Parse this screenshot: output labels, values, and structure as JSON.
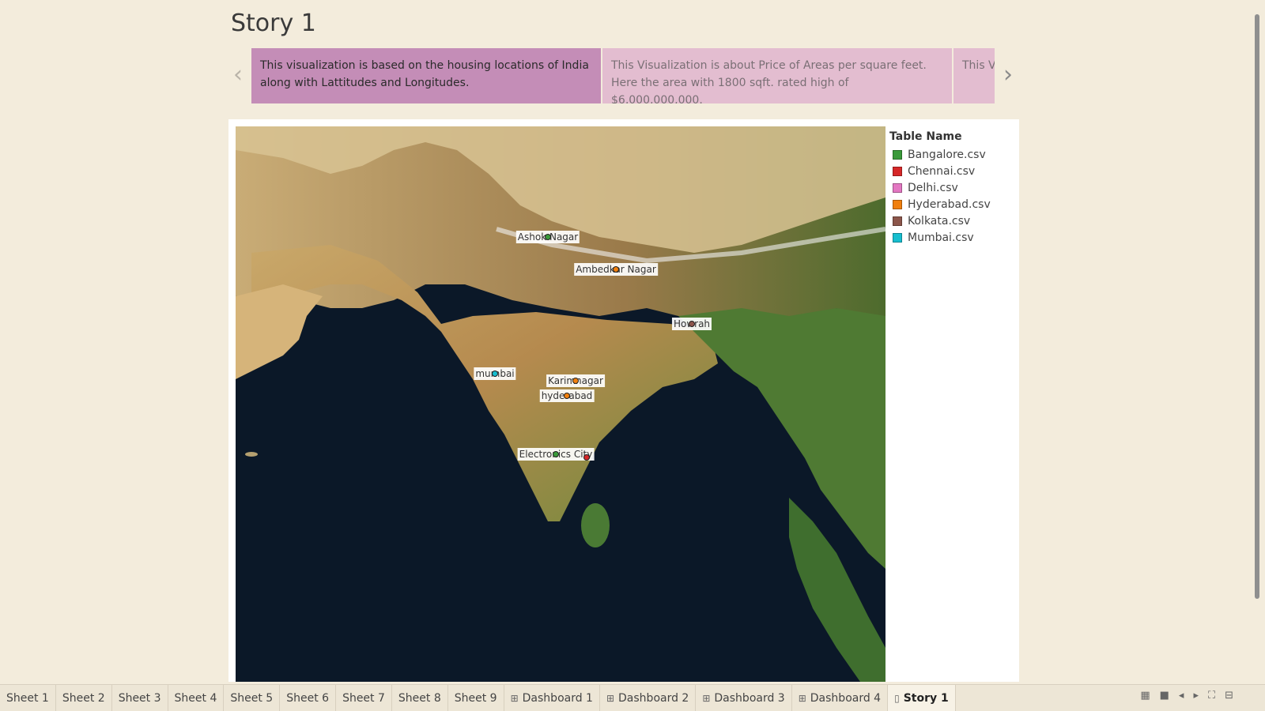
{
  "story": {
    "title": "Story 1",
    "points": [
      {
        "text": "This visualization is based on the housing locations of India along with Lattitudes and Longitudes."
      },
      {
        "text": "This Visualization is about Price of Areas per square feet. Here the area with 1800 sqft. rated high of $6,000,000,000."
      },
      {
        "text": "This V Rainw"
      }
    ],
    "prev_icon": "chevron-left-icon",
    "next_icon": "chevron-right-icon"
  },
  "map": {
    "labels": [
      {
        "text": "Ashok Nagar",
        "city": "Bangalore.csv",
        "color": "#3a9a3a"
      },
      {
        "text": "Ambedkar Nagar",
        "city": "Hyderabad.csv",
        "color": "#f07f0e"
      },
      {
        "text": "Howrah",
        "city": "Kolkata.csv",
        "color": "#8c564b"
      },
      {
        "text": "mumbai",
        "city": "Mumbai.csv",
        "color": "#17becf"
      },
      {
        "text": "Karimnagar",
        "city": "Hyderabad.csv",
        "color": "#f07f0e"
      },
      {
        "text": "hyderabad",
        "city": "Hyderabad.csv",
        "color": "#f07f0e"
      },
      {
        "text": "Electronics City",
        "city": "Bangalore.csv",
        "color": "#3a9a3a"
      }
    ]
  },
  "legend": {
    "title": "Table Name",
    "items": [
      {
        "label": "Bangalore.csv",
        "color": "#3a9a3a"
      },
      {
        "label": "Chennai.csv",
        "color": "#d62728"
      },
      {
        "label": "Delhi.csv",
        "color": "#e377c2"
      },
      {
        "label": "Hyderabad.csv",
        "color": "#f07f0e"
      },
      {
        "label": "Kolkata.csv",
        "color": "#8c564b"
      },
      {
        "label": "Mumbai.csv",
        "color": "#17becf"
      }
    ]
  },
  "tabs": [
    {
      "label": "Sheet 1",
      "icon": ""
    },
    {
      "label": "Sheet 2",
      "icon": ""
    },
    {
      "label": "Sheet 3",
      "icon": ""
    },
    {
      "label": "Sheet 4",
      "icon": ""
    },
    {
      "label": "Sheet 5",
      "icon": ""
    },
    {
      "label": "Sheet 6",
      "icon": ""
    },
    {
      "label": "Sheet 7",
      "icon": ""
    },
    {
      "label": "Sheet 8",
      "icon": ""
    },
    {
      "label": "Sheet 9",
      "icon": ""
    },
    {
      "label": "Dashboard 1",
      "icon": "dashboard-icon"
    },
    {
      "label": "Dashboard 2",
      "icon": "dashboard-icon"
    },
    {
      "label": "Dashboard 3",
      "icon": "dashboard-icon"
    },
    {
      "label": "Dashboard 4",
      "icon": "dashboard-icon"
    },
    {
      "label": "Story 1",
      "icon": "story-icon"
    }
  ],
  "selected_tab": "Story 1"
}
